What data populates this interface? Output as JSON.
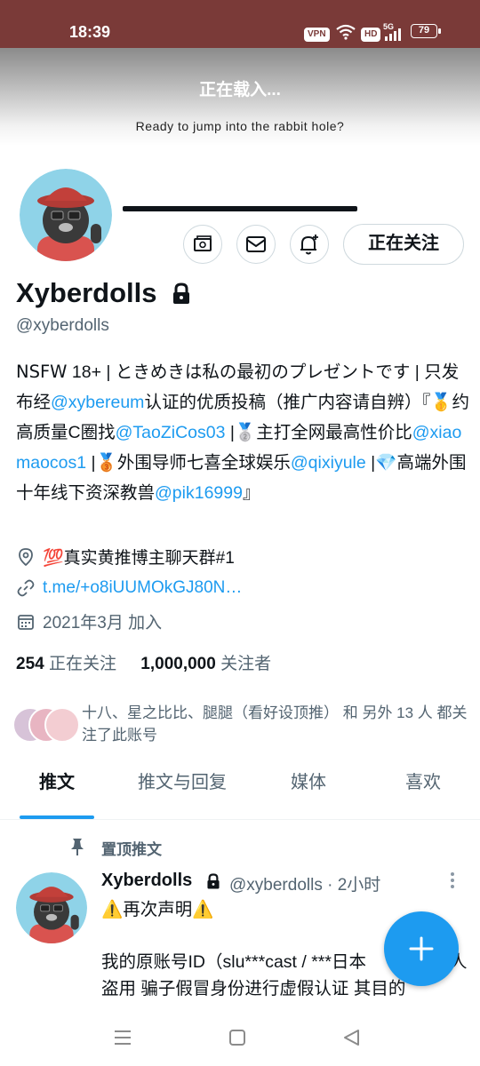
{
  "status_bar": {
    "time": "18:39",
    "vpn": "VPN",
    "hd": "HD",
    "network": "5G",
    "battery": "79"
  },
  "header": {
    "loading_text": "正在载入...",
    "tagline": "Ready to jump into the rabbit hole?"
  },
  "profile": {
    "following_button": "正在关注",
    "display_name": "Xyberdolls",
    "handle": "@xyberdolls",
    "bio": {
      "p1": "𝖭𝖲𝖥𝖶 18+ | ときめきは私の最初のプレゼントです | 只发布经",
      "link1": "@xybereum",
      "p2": "认证的优质投稿（推广内容请自辨）『🥇约高质量C圈找",
      "link2": "@TaoZiCos03",
      "p3": " |🥈主打全网最高性价比",
      "link3": "@xiaomaocos1",
      "p4": " |🥉外围导师七喜全球娱乐",
      "link4": "@qixiyule",
      "p5": " |💎高端外围十年线下资深教兽",
      "link5": "@pik16999",
      "p6": "』"
    },
    "location": "💯真实黄推博主聊天群#1",
    "website": "t.me/+o8iUUMOkGJ80N…",
    "joined": "2021年3月 加入",
    "following_count": "254",
    "following_label": "正在关注",
    "followers_count": "1,000,000",
    "followers_label": "关注者",
    "followers_you_know": "十八、星之比比、腿腿（看好设顶推） 和 另外 13 人 都关注了此账号"
  },
  "tabs": [
    {
      "label": "推文"
    },
    {
      "label": "推文与回复"
    },
    {
      "label": "媒体"
    },
    {
      "label": "喜欢"
    }
  ],
  "pinned_tweet": {
    "pinned_label": "置顶推文",
    "author": "Xyberdolls",
    "meta": "@xyberdolls · 2小时",
    "line1": "⚠️再次声明⚠️",
    "line2": "我的原账号ID（slu***cast / ***日本",
    "line2_end": "人",
    "line3": "盗用 骗子假冒身份进行虚假认证 其目的"
  },
  "colors": {
    "accent": "#1d9bf0",
    "status_bar": "#7a3a38",
    "secondary_text": "#536471"
  },
  "icons": [
    "vpn-icon",
    "wifi-icon",
    "signal-icon",
    "battery-icon",
    "tip-jar-icon",
    "mail-icon",
    "notification-add-icon",
    "lock-icon",
    "location-icon",
    "link-icon",
    "calendar-icon",
    "pin-icon",
    "more-icon",
    "compose-icon",
    "menu-icon",
    "home-icon",
    "back-icon"
  ]
}
